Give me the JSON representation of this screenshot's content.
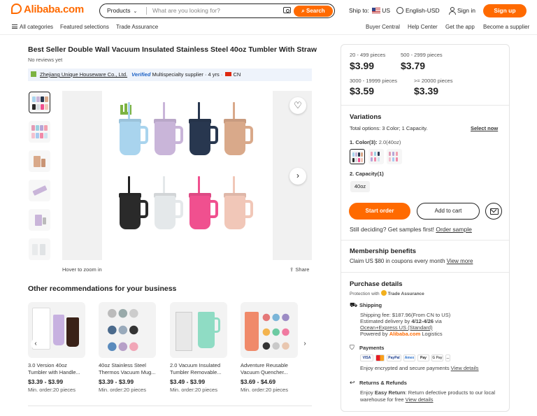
{
  "header": {
    "logo": "Alibaba.com",
    "search_category": "Products",
    "search_placeholder": "What are you looking for?",
    "search_button": "Search",
    "ship_to_label": "Ship to:",
    "ship_to_country": "US",
    "language": "English-USD",
    "sign_in": "Sign in",
    "sign_up": "Sign up"
  },
  "nav": {
    "all_categories": "All categories",
    "featured": "Featured selections",
    "trade_assurance": "Trade Assurance",
    "buyer_central": "Buyer Central",
    "help_center": "Help Center",
    "get_app": "Get the app",
    "become_supplier": "Become a supplier"
  },
  "product": {
    "title": "Best Seller Double Wall Vacuum Insulated Stainless Steel 40oz Tumbler With Straw",
    "reviews": "No reviews yet",
    "supplier_name": "Zhejiang Unique Houseware Co., Ltd.",
    "verified": "Verified",
    "supplier_meta": "Multispecialty supplier · 4 yrs ·",
    "supplier_country": "CN",
    "hover_zoom": "Hover to zoom in",
    "share": "Share"
  },
  "recommendations": {
    "title": "Other recommendations for your business",
    "items": [
      {
        "name": "3.0 Version 40oz Tumbler with Handle...",
        "price": "$3.39 - $3.99",
        "min_order": "Min. order:20 pieces"
      },
      {
        "name": "40oz Stainless Steel Thermos Vacuum Mug...",
        "price": "$3.39 - $3.99",
        "min_order": "Min. order:20 pieces"
      },
      {
        "name": "2.0 Vacuum Insulated Tumbler Removable...",
        "price": "$3.49 - $3.99",
        "min_order": "Min. order:20 pieces"
      },
      {
        "name": "Adventure Reusable Vacuum Quencher...",
        "price": "$3.69 - $4.69",
        "min_order": "Min. order:20 pieces"
      }
    ]
  },
  "pricing": {
    "tiers": [
      {
        "range": "20 - 499 pieces",
        "price": "$3.99"
      },
      {
        "range": "500 - 2999 pieces",
        "price": "$3.79"
      },
      {
        "range": "3000 - 19999 pieces",
        "price": "$3.59"
      },
      {
        "range": ">= 20000 pieces",
        "price": "$3.39"
      }
    ]
  },
  "variations": {
    "title": "Variations",
    "total": "Total options: 3 Color; 1 Capacity.",
    "select_now": "Select now",
    "color_label": "1. Color(3):",
    "color_value": "2.0(40oz)",
    "capacity_label": "2. Capacity(1)",
    "capacity_value": "40oz"
  },
  "actions": {
    "start_order": "Start order",
    "add_to_cart": "Add to cart",
    "still_deciding": "Still deciding? Get samples first!",
    "order_sample": "Order sample"
  },
  "membership": {
    "title": "Membership benefits",
    "text": "Claim US $80 in coupons every month",
    "link": "View more"
  },
  "purchase": {
    "title": "Purchase details",
    "protection": "Protection with",
    "trade_assurance": "Trade Assurance",
    "shipping_title": "Shipping",
    "shipping_fee": "Shipping fee: $187.96(From CN to US)",
    "delivery_prefix": "Estimated delivery by",
    "delivery_dates": "4/12-4/26",
    "delivery_via": "via",
    "carrier": "Ocean+Express US (Standard)",
    "powered_prefix": "Powered by",
    "powered_brand": "Alibaba.com",
    "powered_suffix": "Logistics",
    "payments_title": "Payments",
    "payment_methods": [
      "VISA",
      "MC",
      "PayPal",
      "Amex",
      "Pay",
      "G Pay",
      "..."
    ],
    "payments_text": "Enjoy encrypted and secure payments",
    "payments_link": "View details",
    "returns_title": "Returns & Refunds",
    "returns_prefix": "Enjoy",
    "returns_bold": "Easy Return",
    "returns_text": ": Return defective products to our local",
    "returns_text2": "warehouse for free",
    "returns_link": "View details"
  },
  "icons": {
    "camera": "camera-icon",
    "globe": "globe-icon",
    "user": "user-icon",
    "heart": "heart-icon",
    "share": "share-icon",
    "mail": "mail-icon"
  },
  "colors": {
    "accent": "#ff6a00",
    "verified": "#1e63c6",
    "cups_top": [
      "#a9d4ee",
      "#c9b5d9",
      "#28374f",
      "#d9a98a"
    ],
    "cups_bottom": [
      "#2a2a2a",
      "#e4e8ea",
      "#f0508f",
      "#f1c7b8"
    ]
  }
}
